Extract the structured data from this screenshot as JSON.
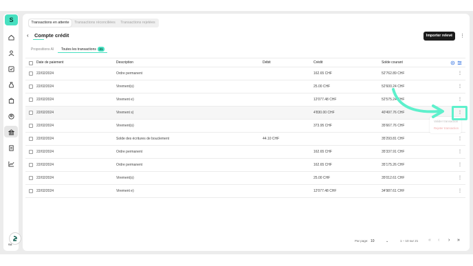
{
  "top_tabs": [
    {
      "label": "Transactions en attente",
      "active": true
    },
    {
      "label": "Transactions réconciliées",
      "active": false
    },
    {
      "label": "Transactions rejetées",
      "active": false
    }
  ],
  "page": {
    "title": "Compte crédit",
    "back_icon": "chevron-left-icon"
  },
  "toolbar": {
    "import_label": "Importer relevé"
  },
  "subtabs": [
    {
      "label": "Propositions AI",
      "active": false
    },
    {
      "label": "Toutes les transactions",
      "active": true,
      "count": "21"
    }
  ],
  "table": {
    "headers": {
      "date": "Date de paiement",
      "description": "Description",
      "debit": "Débit",
      "credit": "Crédit",
      "balance": "Solde courant"
    },
    "rows": [
      {
        "date": "22/02/2024",
        "description": "Ordre permanent",
        "debit": "",
        "credit": "162.65 CHF",
        "balance": "52'762.89 CHF"
      },
      {
        "date": "22/02/2024",
        "description": "Virement(s)",
        "debit": "",
        "credit": "25.00 CHF",
        "balance": "52'600.24 CHF"
      },
      {
        "date": "22/02/2024",
        "description": "Virement e)",
        "debit": "",
        "credit": "12'077.48 CHF",
        "balance": "52'575.24 CHF"
      },
      {
        "date": "22/02/2024",
        "description": "Virement s)",
        "debit": "",
        "credit": "4'830.00 CHF",
        "balance": "40'497.76 CHF"
      },
      {
        "date": "22/02/2024",
        "description": "Virement(s)",
        "debit": "",
        "credit": "373.95 CHF",
        "balance": "35'667.76 CHF"
      },
      {
        "date": "22/02/2024",
        "description": "Solde des écritures de bouclement",
        "debit": "44.10 CHF",
        "credit": "",
        "balance": "35'293.81 CHF"
      },
      {
        "date": "22/02/2024",
        "description": "Ordre permanent",
        "debit": "",
        "credit": "162.65 CHF",
        "balance": "35'337.91 CHF"
      },
      {
        "date": "22/02/2024",
        "description": "Ordre permanent",
        "debit": "",
        "credit": "162.65 CHF",
        "balance": "35'175.26 CHF"
      },
      {
        "date": "22/02/2024",
        "description": "Virement(s)",
        "debit": "",
        "credit": "25.00 CHF",
        "balance": "35'012.61 CHF"
      },
      {
        "date": "22/02/2024",
        "description": "Virement e)",
        "debit": "",
        "credit": "12'077.48 CHF",
        "balance": "34'987.61 CHF"
      }
    ]
  },
  "row_menu": {
    "item_1": "Valider transaction",
    "item_2": "Rejeter transaction"
  },
  "pagination": {
    "per_page_label": "Par page:",
    "per_page_value": "10",
    "range": "1 – 10 sur 21"
  },
  "user": {
    "avatar_tag": "SA"
  },
  "colors": {
    "accent": "#47e0c0",
    "highlight": "#5ef0cc",
    "primary_button": "#1c1c1c"
  }
}
